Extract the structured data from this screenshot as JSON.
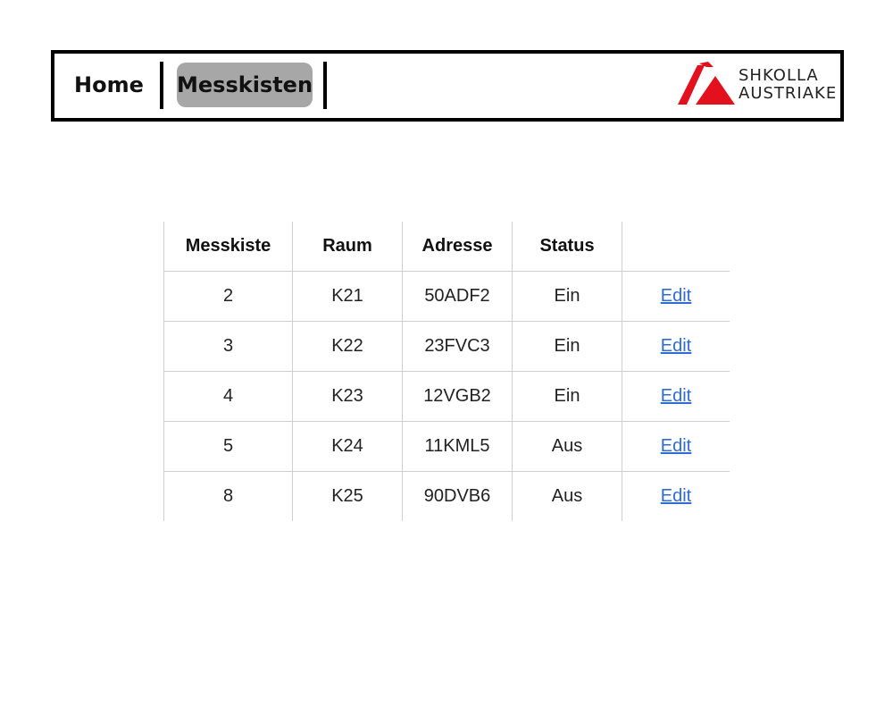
{
  "nav": {
    "home_label": "Home",
    "active_label": "Messkisten"
  },
  "logo": {
    "line1": "SHKOLLA",
    "line2": "AUSTRIAKE",
    "color": "#e3101e"
  },
  "table": {
    "headers": [
      "Messkiste",
      "Raum",
      "Adresse",
      "Status",
      ""
    ],
    "rows": [
      {
        "messkiste": "2",
        "raum": "K21",
        "adresse": "50ADF2",
        "status": "Ein",
        "action": "Edit"
      },
      {
        "messkiste": "3",
        "raum": "K22",
        "adresse": "23FVC3",
        "status": "Ein",
        "action": "Edit"
      },
      {
        "messkiste": "4",
        "raum": "K23",
        "adresse": "12VGB2",
        "status": "Ein",
        "action": "Edit"
      },
      {
        "messkiste": "5",
        "raum": "K24",
        "adresse": "11KML5",
        "status": "Aus",
        "action": "Edit"
      },
      {
        "messkiste": "8",
        "raum": "K25",
        "adresse": "90DVB6",
        "status": "Aus",
        "action": "Edit"
      }
    ]
  }
}
